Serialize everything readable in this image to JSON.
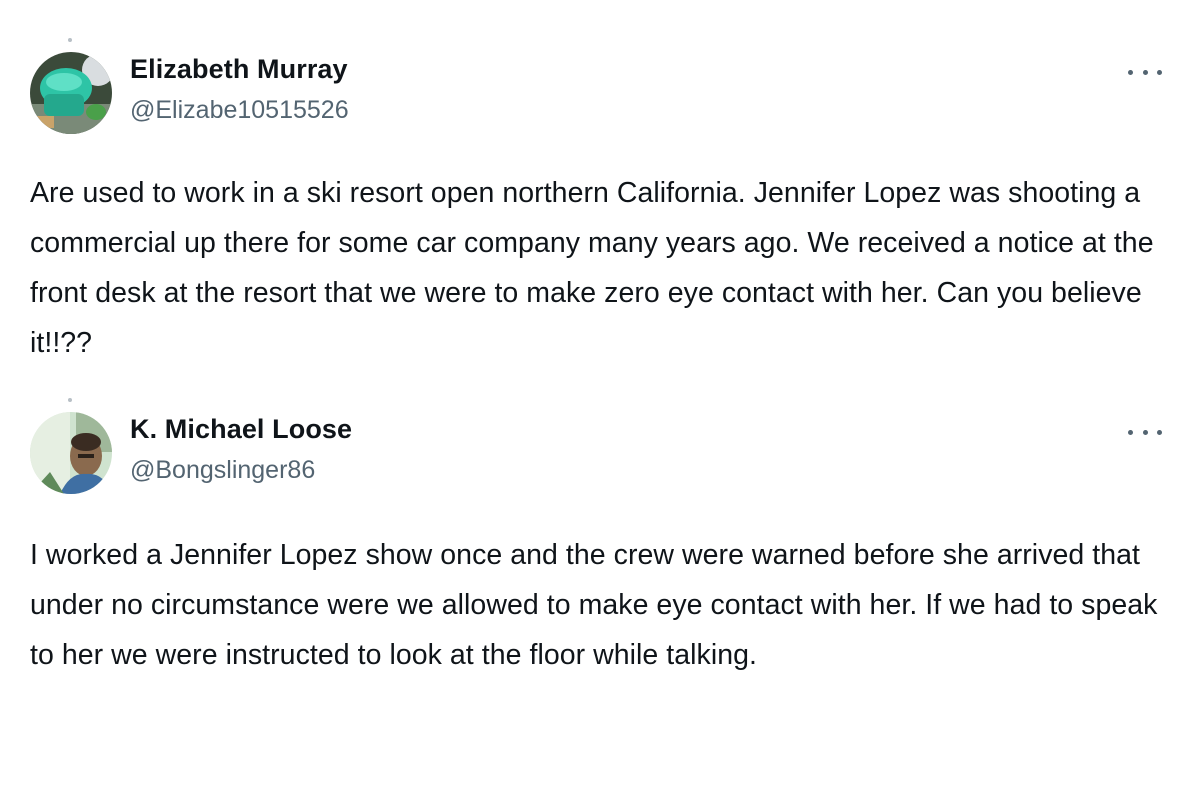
{
  "tweets": [
    {
      "author": {
        "name": "Elizabeth Murray",
        "handle": "@Elizabe10515526",
        "avatar_icon": "green-cup-photo-avatar"
      },
      "more_icon": "more-options-ellipsis-icon",
      "text": "Are used to work in a ski resort open northern California. Jennifer Lopez was shooting a commercial up there for some car company many years ago. We received a notice at the front desk at the resort that we were to make zero eye contact with her. Can you believe it!!??"
    },
    {
      "author": {
        "name": "K. Michael Loose",
        "handle": "@Bongslinger86",
        "avatar_icon": "man-selfie-photo-avatar"
      },
      "more_icon": "more-options-ellipsis-icon",
      "text": "I worked a Jennifer Lopez show once and the crew were warned before she arrived that under no circumstance were we allowed to make eye contact with her. If we had to speak to her we were instructed to look at the floor while talking."
    }
  ],
  "colors": {
    "text_primary": "#0f1419",
    "text_secondary": "#536471",
    "background": "#ffffff"
  }
}
